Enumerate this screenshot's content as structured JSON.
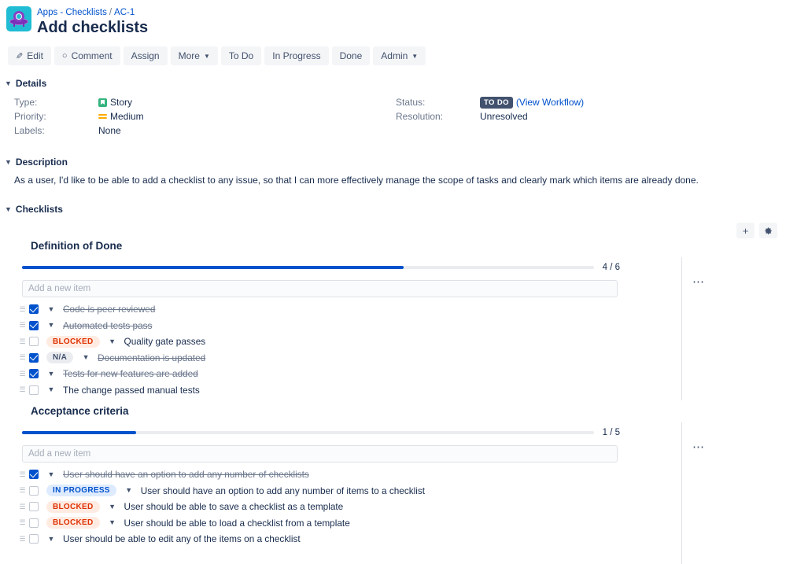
{
  "header": {
    "logo_icon": "ufo-project-avatar",
    "breadcrumb": {
      "project": "Apps - Checklists",
      "separator": "/",
      "issue_key": "AC-1"
    },
    "title": "Add checklists"
  },
  "toolbar": {
    "edit": "Edit",
    "edit_icon": "pencil-icon",
    "comment": "Comment",
    "comment_icon": "comment-bubble-icon",
    "assign": "Assign",
    "more": "More",
    "todo": "To Do",
    "in_progress": "In Progress",
    "done": "Done",
    "admin": "Admin",
    "caret_icon": "chevron-down-icon"
  },
  "details": {
    "heading": "Details",
    "left": [
      {
        "label": "Type:",
        "value": "Story",
        "icon": "story-type-icon"
      },
      {
        "label": "Priority:",
        "value": "Medium",
        "icon": "priority-medium-icon"
      },
      {
        "label": "Labels:",
        "value": "None",
        "icon": ""
      }
    ],
    "right": [
      {
        "label": "Status:",
        "value": "TO DO",
        "link": "(View Workflow)"
      },
      {
        "label": "Resolution:",
        "value": "Unresolved",
        "link": ""
      }
    ]
  },
  "description": {
    "heading": "Description",
    "body": "As a user, I'd like to be able to add a checklist to any issue, so that I can more effectively manage the scope of tasks and clearly mark which items are already done."
  },
  "checklists": {
    "heading": "Checklists",
    "add_button_icon": "plus-icon",
    "settings_button_icon": "gear-icon",
    "overflow_icon": "ellipsis-icon",
    "new_item_placeholder": "Add a new item",
    "sections": [
      {
        "title": "Definition of Done",
        "progress_label": "4 / 6",
        "progress_done": 4,
        "progress_total": 6,
        "items": [
          {
            "checked": true,
            "status": "",
            "text": "Code is peer reviewed"
          },
          {
            "checked": true,
            "status": "",
            "text": "Automated tests pass"
          },
          {
            "checked": false,
            "status": "BLOCKED",
            "text": "Quality gate passes"
          },
          {
            "checked": true,
            "status": "N/A",
            "text": "Documentation is updated"
          },
          {
            "checked": true,
            "status": "",
            "text": "Tests for new features are added"
          },
          {
            "checked": false,
            "status": "",
            "text": "The change passed manual tests"
          }
        ]
      },
      {
        "title": "Acceptance criteria",
        "progress_label": "1 / 5",
        "progress_done": 1,
        "progress_total": 5,
        "items": [
          {
            "checked": true,
            "status": "",
            "text": "User should have an option to add any number of checklists"
          },
          {
            "checked": false,
            "status": "IN PROGRESS",
            "text": "User should have an option to add any number of items to a checklist"
          },
          {
            "checked": false,
            "status": "BLOCKED",
            "text": "User should be able to save a checklist as a template"
          },
          {
            "checked": false,
            "status": "BLOCKED",
            "text": "User should be able to load a checklist from a template"
          },
          {
            "checked": false,
            "status": "",
            "text": "User should be able to edit any of the items on a checklist"
          }
        ]
      }
    ]
  },
  "colors": {
    "accent": "#0052cc",
    "text": "#172b4d",
    "muted": "#6b778c",
    "blocked_bg": "#ffebe2",
    "blocked_fg": "#de3000",
    "inprogress_bg": "#deebff",
    "inprogress_fg": "#0052cc",
    "na_bg": "#ebecf0",
    "na_fg": "#42526e",
    "status_pill_bg": "#42526e",
    "logo_bg": "#1fbcd4"
  }
}
